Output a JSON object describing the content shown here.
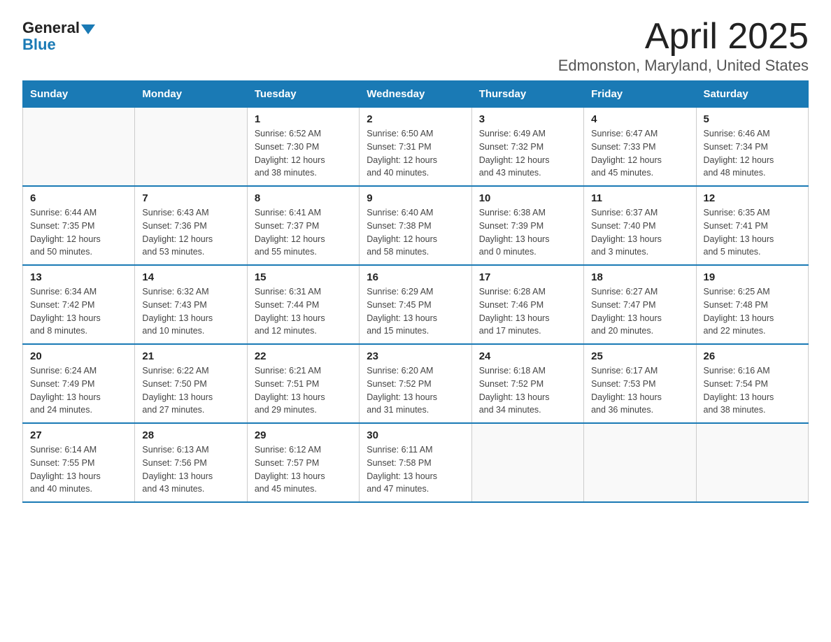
{
  "logo": {
    "general": "General",
    "blue": "Blue"
  },
  "title": "April 2025",
  "subtitle": "Edmonston, Maryland, United States",
  "weekdays": [
    "Sunday",
    "Monday",
    "Tuesday",
    "Wednesday",
    "Thursday",
    "Friday",
    "Saturday"
  ],
  "weeks": [
    [
      {
        "day": "",
        "info": ""
      },
      {
        "day": "",
        "info": ""
      },
      {
        "day": "1",
        "info": "Sunrise: 6:52 AM\nSunset: 7:30 PM\nDaylight: 12 hours\nand 38 minutes."
      },
      {
        "day": "2",
        "info": "Sunrise: 6:50 AM\nSunset: 7:31 PM\nDaylight: 12 hours\nand 40 minutes."
      },
      {
        "day": "3",
        "info": "Sunrise: 6:49 AM\nSunset: 7:32 PM\nDaylight: 12 hours\nand 43 minutes."
      },
      {
        "day": "4",
        "info": "Sunrise: 6:47 AM\nSunset: 7:33 PM\nDaylight: 12 hours\nand 45 minutes."
      },
      {
        "day": "5",
        "info": "Sunrise: 6:46 AM\nSunset: 7:34 PM\nDaylight: 12 hours\nand 48 minutes."
      }
    ],
    [
      {
        "day": "6",
        "info": "Sunrise: 6:44 AM\nSunset: 7:35 PM\nDaylight: 12 hours\nand 50 minutes."
      },
      {
        "day": "7",
        "info": "Sunrise: 6:43 AM\nSunset: 7:36 PM\nDaylight: 12 hours\nand 53 minutes."
      },
      {
        "day": "8",
        "info": "Sunrise: 6:41 AM\nSunset: 7:37 PM\nDaylight: 12 hours\nand 55 minutes."
      },
      {
        "day": "9",
        "info": "Sunrise: 6:40 AM\nSunset: 7:38 PM\nDaylight: 12 hours\nand 58 minutes."
      },
      {
        "day": "10",
        "info": "Sunrise: 6:38 AM\nSunset: 7:39 PM\nDaylight: 13 hours\nand 0 minutes."
      },
      {
        "day": "11",
        "info": "Sunrise: 6:37 AM\nSunset: 7:40 PM\nDaylight: 13 hours\nand 3 minutes."
      },
      {
        "day": "12",
        "info": "Sunrise: 6:35 AM\nSunset: 7:41 PM\nDaylight: 13 hours\nand 5 minutes."
      }
    ],
    [
      {
        "day": "13",
        "info": "Sunrise: 6:34 AM\nSunset: 7:42 PM\nDaylight: 13 hours\nand 8 minutes."
      },
      {
        "day": "14",
        "info": "Sunrise: 6:32 AM\nSunset: 7:43 PM\nDaylight: 13 hours\nand 10 minutes."
      },
      {
        "day": "15",
        "info": "Sunrise: 6:31 AM\nSunset: 7:44 PM\nDaylight: 13 hours\nand 12 minutes."
      },
      {
        "day": "16",
        "info": "Sunrise: 6:29 AM\nSunset: 7:45 PM\nDaylight: 13 hours\nand 15 minutes."
      },
      {
        "day": "17",
        "info": "Sunrise: 6:28 AM\nSunset: 7:46 PM\nDaylight: 13 hours\nand 17 minutes."
      },
      {
        "day": "18",
        "info": "Sunrise: 6:27 AM\nSunset: 7:47 PM\nDaylight: 13 hours\nand 20 minutes."
      },
      {
        "day": "19",
        "info": "Sunrise: 6:25 AM\nSunset: 7:48 PM\nDaylight: 13 hours\nand 22 minutes."
      }
    ],
    [
      {
        "day": "20",
        "info": "Sunrise: 6:24 AM\nSunset: 7:49 PM\nDaylight: 13 hours\nand 24 minutes."
      },
      {
        "day": "21",
        "info": "Sunrise: 6:22 AM\nSunset: 7:50 PM\nDaylight: 13 hours\nand 27 minutes."
      },
      {
        "day": "22",
        "info": "Sunrise: 6:21 AM\nSunset: 7:51 PM\nDaylight: 13 hours\nand 29 minutes."
      },
      {
        "day": "23",
        "info": "Sunrise: 6:20 AM\nSunset: 7:52 PM\nDaylight: 13 hours\nand 31 minutes."
      },
      {
        "day": "24",
        "info": "Sunrise: 6:18 AM\nSunset: 7:52 PM\nDaylight: 13 hours\nand 34 minutes."
      },
      {
        "day": "25",
        "info": "Sunrise: 6:17 AM\nSunset: 7:53 PM\nDaylight: 13 hours\nand 36 minutes."
      },
      {
        "day": "26",
        "info": "Sunrise: 6:16 AM\nSunset: 7:54 PM\nDaylight: 13 hours\nand 38 minutes."
      }
    ],
    [
      {
        "day": "27",
        "info": "Sunrise: 6:14 AM\nSunset: 7:55 PM\nDaylight: 13 hours\nand 40 minutes."
      },
      {
        "day": "28",
        "info": "Sunrise: 6:13 AM\nSunset: 7:56 PM\nDaylight: 13 hours\nand 43 minutes."
      },
      {
        "day": "29",
        "info": "Sunrise: 6:12 AM\nSunset: 7:57 PM\nDaylight: 13 hours\nand 45 minutes."
      },
      {
        "day": "30",
        "info": "Sunrise: 6:11 AM\nSunset: 7:58 PM\nDaylight: 13 hours\nand 47 minutes."
      },
      {
        "day": "",
        "info": ""
      },
      {
        "day": "",
        "info": ""
      },
      {
        "day": "",
        "info": ""
      }
    ]
  ]
}
